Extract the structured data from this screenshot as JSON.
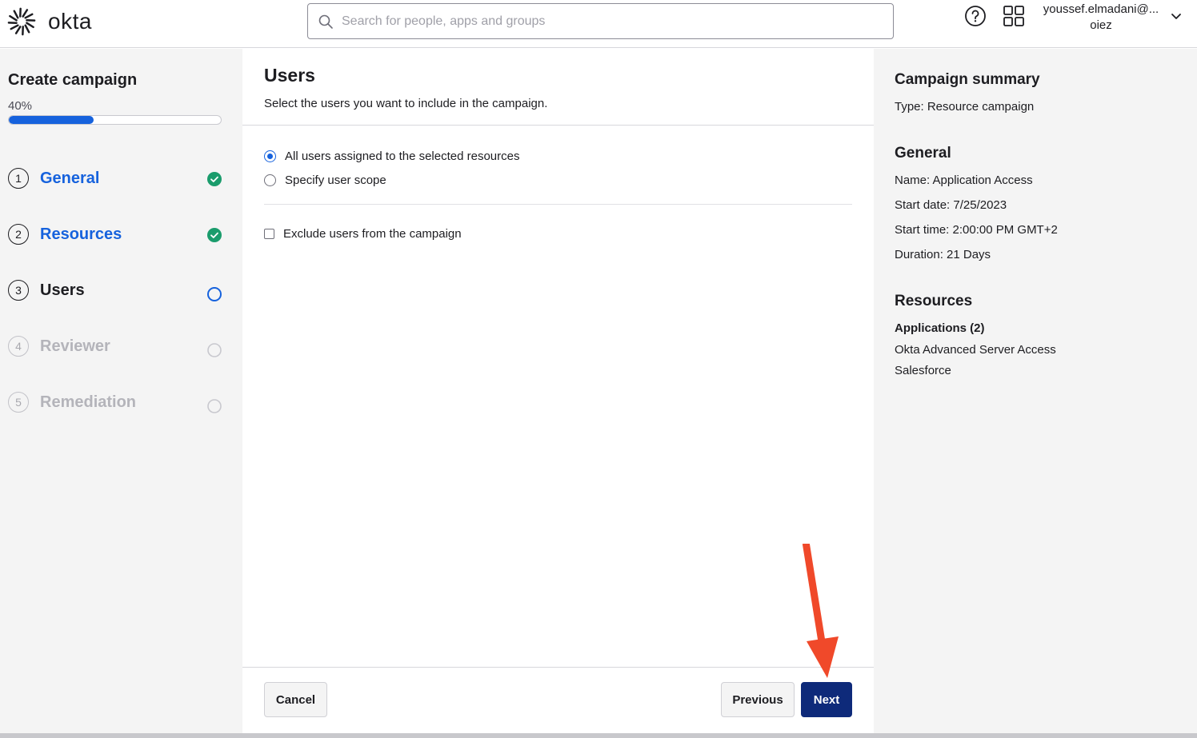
{
  "header": {
    "logo_text": "okta",
    "search_placeholder": "Search for people, apps and groups",
    "user_name": "youssef.elmadani@...",
    "user_org": "oiez",
    "icons": [
      "help-icon",
      "apps-grid-icon",
      "chevron-down-icon",
      "search-icon"
    ]
  },
  "sidebar": {
    "title": "Create campaign",
    "progress_label": "40%",
    "progress_value": 0.4,
    "steps": [
      {
        "num": "1",
        "label": "General",
        "status": "done"
      },
      {
        "num": "2",
        "label": "Resources",
        "status": "done"
      },
      {
        "num": "3",
        "label": "Users",
        "status": "current"
      },
      {
        "num": "4",
        "label": "Reviewer",
        "status": "pending"
      },
      {
        "num": "5",
        "label": "Remediation",
        "status": "pending"
      }
    ]
  },
  "main": {
    "title": "Users",
    "subtitle": "Select the users you want to include in the campaign.",
    "options": [
      {
        "label": "All users assigned to the selected resources",
        "selected": true
      },
      {
        "label": "Specify user scope",
        "selected": false
      }
    ],
    "exclude_label": "Exclude users from the campaign",
    "exclude_checked": false,
    "buttons": {
      "cancel": "Cancel",
      "previous": "Previous",
      "next": "Next"
    }
  },
  "summary": {
    "title": "Campaign summary",
    "type": "Type: Resource campaign",
    "general_heading": "General",
    "name": "Name: Application Access",
    "start_date": "Start date: 7/25/2023",
    "start_time": "Start time: 2:00:00 PM GMT+2",
    "duration": "Duration: 21 Days",
    "resources_heading": "Resources",
    "applications_heading": "Applications (2)",
    "applications": [
      "Okta Advanced Server Access",
      "Salesforce"
    ]
  },
  "colors": {
    "accent": "#1662dd",
    "primary_button": "#0e2a7a",
    "success": "#1a9c6c",
    "annotation_arrow": "#f0492a",
    "panel_bg": "#f4f4f4"
  }
}
